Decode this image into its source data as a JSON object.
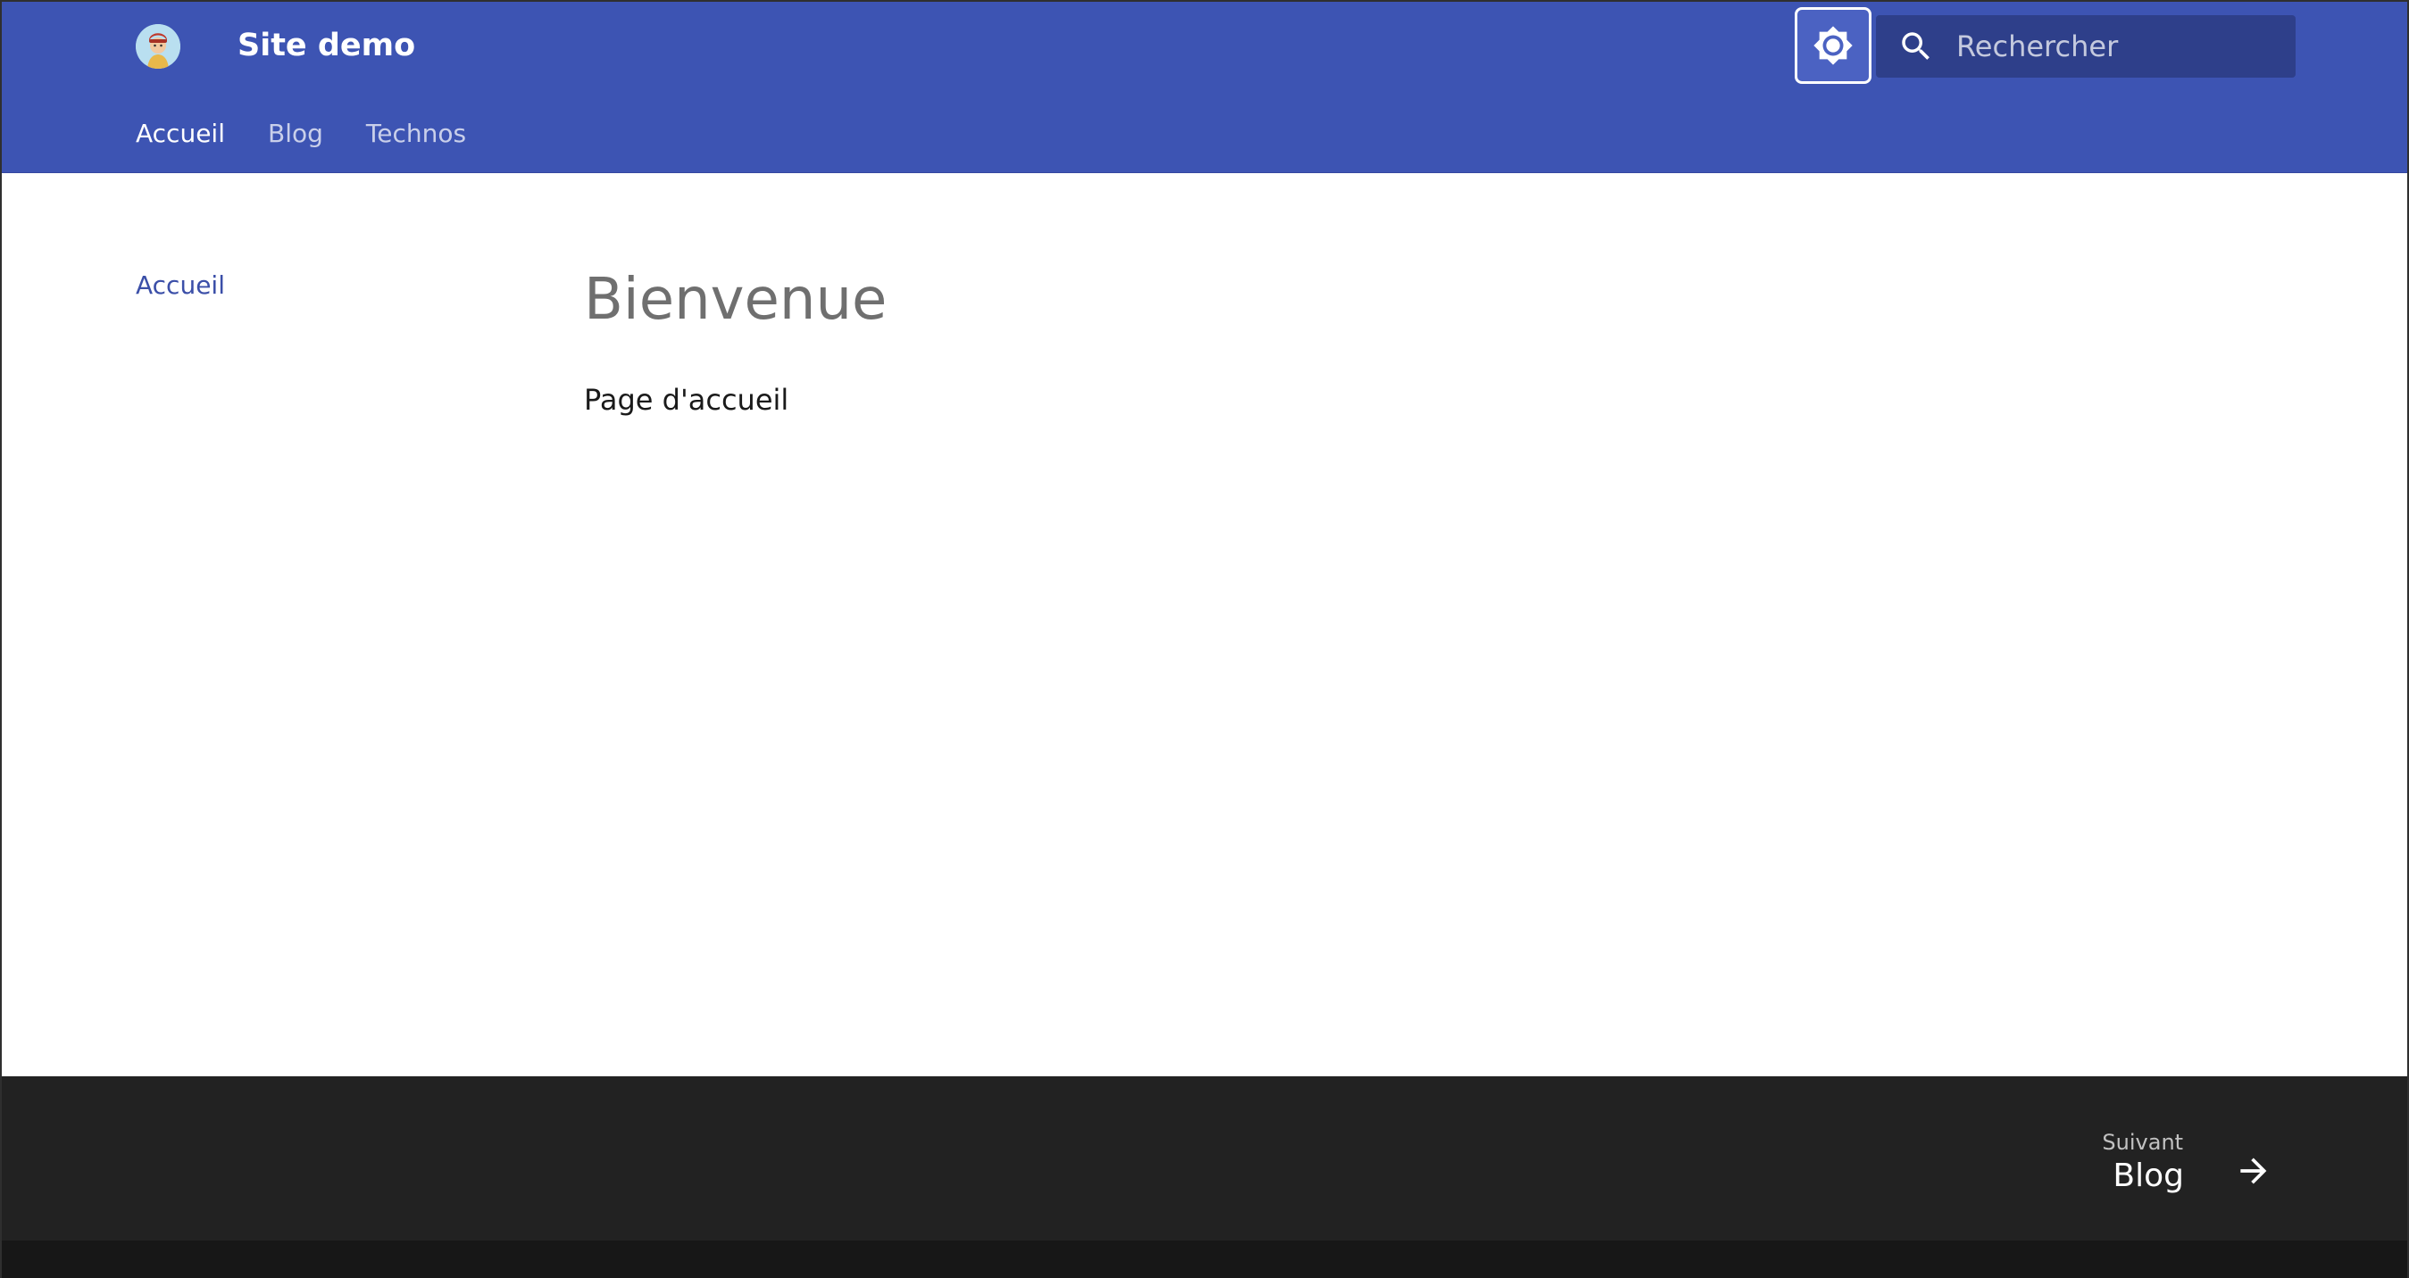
{
  "header": {
    "site_title": "Site demo",
    "logo_icon": "avatar-logo",
    "theme_toggle_icon": "brightness-icon",
    "search": {
      "placeholder": "Rechercher",
      "value": "",
      "icon": "search-icon"
    },
    "tabs": [
      {
        "label": "Accueil",
        "active": true
      },
      {
        "label": "Blog",
        "active": false
      },
      {
        "label": "Technos",
        "active": false
      }
    ]
  },
  "sidebar": {
    "items": [
      {
        "label": "Accueil",
        "active": true
      }
    ]
  },
  "main": {
    "title": "Bienvenue",
    "text": "Page d'accueil"
  },
  "footer": {
    "next": {
      "caption": "Suivant",
      "title": "Blog",
      "icon": "arrow-right-icon"
    }
  },
  "colors": {
    "primary": "#3d54b3",
    "search_bg": "#2e3f8a",
    "link": "#3b4fa8",
    "heading": "#6f6f6f",
    "footer_bg": "#222222",
    "footer_bottom_bg": "#171717"
  }
}
